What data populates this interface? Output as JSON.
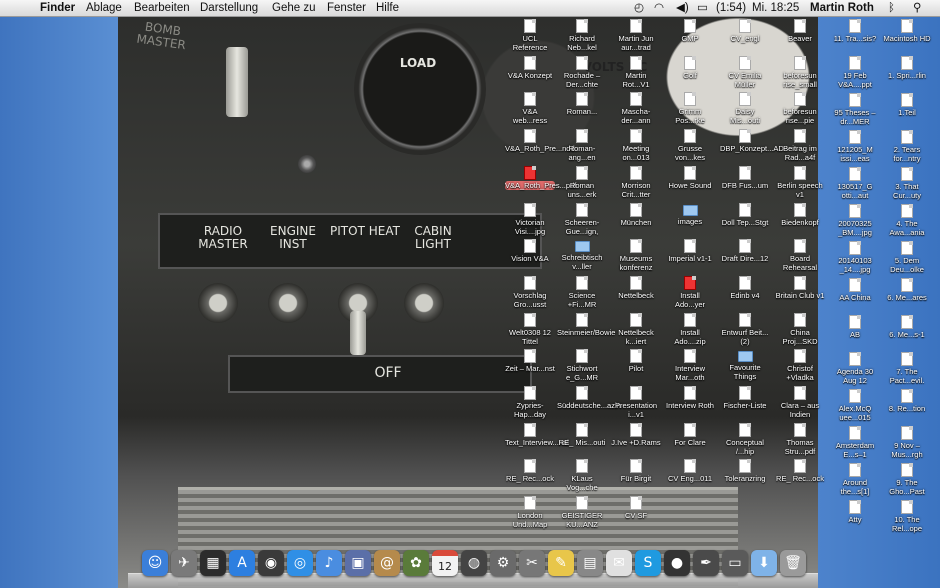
{
  "menubar": {
    "apple_icon": "apple-icon",
    "app_name": "Finder",
    "menus": [
      "Ablage",
      "Bearbeiten",
      "Darstellung",
      "Gehe zu",
      "Fenster",
      "Hilfe"
    ],
    "battery_text": "(1:54)",
    "clock": "Mi. 18:25",
    "user": "Martin Roth"
  },
  "wallpaper": {
    "gauge_top_label": "LOAD",
    "gauge_right_label": "VOLTS DC",
    "switch_labels": [
      "RADIO MASTER",
      "ENGINE INST",
      "PITOT HEAT",
      "CABIN LIGHT"
    ],
    "off_label": "OFF",
    "corner_label": "BOMB MASTER"
  },
  "desktop_icons": [
    {
      "label": "UCL Reference",
      "kind": "doc"
    },
    {
      "label": "Richard Neb...kel",
      "kind": "doc"
    },
    {
      "label": "Martin Jun aur...trad",
      "kind": "doc"
    },
    {
      "label": "GMP",
      "kind": "doc"
    },
    {
      "label": "CV_engl",
      "kind": "doc"
    },
    {
      "label": "Beaver",
      "kind": "doc"
    },
    {
      "label": "V&A Konzept",
      "kind": "doc"
    },
    {
      "label": "Rochade – Der...chte",
      "kind": "doc"
    },
    {
      "label": "Martin Rot...V1",
      "kind": "doc"
    },
    {
      "label": "Golf",
      "kind": "doc"
    },
    {
      "label": "CV Emilia Müller",
      "kind": "doc"
    },
    {
      "label": "beforesun rise_small",
      "kind": "doc"
    },
    {
      "label": "V&A web...ress",
      "kind": "doc"
    },
    {
      "label": "Roman...",
      "kind": "doc"
    },
    {
      "label": "Mascha-der...ann",
      "kind": "doc"
    },
    {
      "label": "Grimm Pos...rke",
      "kind": "doc"
    },
    {
      "label": "Daisy Mis...outi",
      "kind": "doc"
    },
    {
      "label": "beforesun rise...pie",
      "kind": "doc"
    },
    {
      "label": "V&A_Roth_Pre...ndd",
      "kind": "doc"
    },
    {
      "label": "Roman-ang...en",
      "kind": "doc"
    },
    {
      "label": "Meeting on...013",
      "kind": "doc"
    },
    {
      "label": "Grusse von...kes",
      "kind": "doc"
    },
    {
      "label": "DBP_Konzept...AD",
      "kind": "doc"
    },
    {
      "label": "Beitrag im Rad...a4f",
      "kind": "doc"
    },
    {
      "label": "V&A_Roth_Pres...pdf",
      "kind": "pdf",
      "selected": true
    },
    {
      "label": "Roman uns...erk",
      "kind": "doc"
    },
    {
      "label": "Morrison Crit...tter",
      "kind": "doc"
    },
    {
      "label": "Howe Sound",
      "kind": "doc"
    },
    {
      "label": "DFB Fus...um",
      "kind": "doc"
    },
    {
      "label": "Berlin speech v1",
      "kind": "doc"
    },
    {
      "label": "Victorian Visi....jpg",
      "kind": "doc"
    },
    {
      "label": "Scheeren-Gue...ign,",
      "kind": "doc"
    },
    {
      "label": "München",
      "kind": "doc"
    },
    {
      "label": "images",
      "kind": "folder"
    },
    {
      "label": "Doll Tep...Stgt",
      "kind": "doc"
    },
    {
      "label": "Biedenkopf",
      "kind": "doc"
    },
    {
      "label": "Vision V&A",
      "kind": "doc"
    },
    {
      "label": "Schreibtisch v...ller",
      "kind": "folder"
    },
    {
      "label": "Museums konferenz",
      "kind": "doc"
    },
    {
      "label": "Imperial v1-1",
      "kind": "doc"
    },
    {
      "label": "Draft Dire...12",
      "kind": "doc"
    },
    {
      "label": "Board Rehearsal",
      "kind": "doc"
    },
    {
      "label": "Vorschlag Gro...usst",
      "kind": "doc"
    },
    {
      "label": "Science +Fi...MR",
      "kind": "doc"
    },
    {
      "label": "Nettelbeck",
      "kind": "doc"
    },
    {
      "label": "Install Ado...yer",
      "kind": "pdf"
    },
    {
      "label": "Edinb v4",
      "kind": "doc"
    },
    {
      "label": "Britain Club v1",
      "kind": "doc"
    },
    {
      "label": "Welt0308 12 Tittel",
      "kind": "doc"
    },
    {
      "label": "Steinmeier/Bowie",
      "kind": "doc"
    },
    {
      "label": "Nettelbeck k...iert",
      "kind": "doc"
    },
    {
      "label": "Install Ado....zip",
      "kind": "doc"
    },
    {
      "label": "Entwurf Beit...(2)",
      "kind": "doc"
    },
    {
      "label": "China Proj...SKD",
      "kind": "doc"
    },
    {
      "label": "Zeit – Mar...nst",
      "kind": "doc"
    },
    {
      "label": "Stichwort e_G...MR",
      "kind": "doc"
    },
    {
      "label": "Pilot",
      "kind": "doc"
    },
    {
      "label": "Interview Mar...oth",
      "kind": "doc"
    },
    {
      "label": "Favourite Things",
      "kind": "folder"
    },
    {
      "label": "Christof +Vladka",
      "kind": "doc"
    },
    {
      "label": "Zypries-Hap...day",
      "kind": "doc"
    },
    {
      "label": "Süddeutsche...azin",
      "kind": "doc"
    },
    {
      "label": "Presentation i...v1",
      "kind": "doc"
    },
    {
      "label": "Interview Roth",
      "kind": "doc"
    },
    {
      "label": "Fischer-Liste",
      "kind": "doc"
    },
    {
      "label": "Clara – aus Indien",
      "kind": "doc"
    },
    {
      "label": "Text_Interview...nal",
      "kind": "doc"
    },
    {
      "label": "RE_ Mis...outi",
      "kind": "doc"
    },
    {
      "label": "J.Ive +D.Rams",
      "kind": "doc"
    },
    {
      "label": "For Clare",
      "kind": "doc"
    },
    {
      "label": "Conceptual /...hip",
      "kind": "doc"
    },
    {
      "label": "Thomas Stru...pdf",
      "kind": "doc"
    },
    {
      "label": "RE_ Rec...ock",
      "kind": "doc"
    },
    {
      "label": "KLaus Vog...che",
      "kind": "doc"
    },
    {
      "label": "Für Birgit",
      "kind": "doc"
    },
    {
      "label": "CV Eng...011",
      "kind": "doc"
    },
    {
      "label": "Toleranzring",
      "kind": "doc"
    },
    {
      "label": "RE_ Rec...ock",
      "kind": "doc"
    },
    {
      "label": "London Und...Map",
      "kind": "doc"
    },
    {
      "label": "GEISTIGER KU...ANZ",
      "kind": "doc"
    },
    {
      "label": "CV SF",
      "kind": "doc"
    },
    {
      "label": "11. Tra...sis?",
      "kind": "doc"
    },
    {
      "label": "Macintosh HD",
      "kind": "doc"
    },
    {
      "label": "19 Feb V&A....ppt",
      "kind": "doc"
    },
    {
      "label": "1. Spri...rlin",
      "kind": "doc"
    },
    {
      "label": "95 Theses – dr...MER",
      "kind": "doc"
    },
    {
      "label": "1.Teil",
      "kind": "doc"
    },
    {
      "label": "121205_M issi...eas",
      "kind": "doc"
    },
    {
      "label": "2. Tears for...ntry",
      "kind": "doc"
    },
    {
      "label": "130517_G otti...aut",
      "kind": "doc"
    },
    {
      "label": "3. That Cur...uty",
      "kind": "doc"
    },
    {
      "label": "20070325 _BM....jpg",
      "kind": "doc"
    },
    {
      "label": "4. The Awa...ania",
      "kind": "doc"
    },
    {
      "label": "20140103 _14....jpg",
      "kind": "doc"
    },
    {
      "label": "5. Dem Deu...olke",
      "kind": "doc"
    },
    {
      "label": "AA China",
      "kind": "doc"
    },
    {
      "label": "6. Me...ares",
      "kind": "doc"
    },
    {
      "label": "AB",
      "kind": "doc"
    },
    {
      "label": "6. Me...s-1",
      "kind": "doc"
    },
    {
      "label": "Agenda 30 Aug 12",
      "kind": "doc"
    },
    {
      "label": "7. The Pact...evil.",
      "kind": "doc"
    },
    {
      "label": "Alex.McQ uee...015",
      "kind": "doc"
    },
    {
      "label": "8. Re...tion",
      "kind": "doc"
    },
    {
      "label": "Amsterdam E...s–1",
      "kind": "doc"
    },
    {
      "label": "9 Nov – Mus...rgh",
      "kind": "doc"
    },
    {
      "label": "Around the...s[1]",
      "kind": "doc"
    },
    {
      "label": "9. The Gho...Past",
      "kind": "doc"
    },
    {
      "label": "Atty",
      "kind": "doc"
    },
    {
      "label": "10. The Rel...ope",
      "kind": "doc"
    }
  ],
  "dock": {
    "apps": [
      {
        "name": "finder-icon",
        "color": "#3b7fd9",
        "glyph": "☺"
      },
      {
        "name": "launchpad-icon",
        "color": "#7a7a7a",
        "glyph": "✈"
      },
      {
        "name": "mission-control-icon",
        "color": "#2c2c2c",
        "glyph": "▦"
      },
      {
        "name": "app-store-icon",
        "color": "#2d7fe0",
        "glyph": "A"
      },
      {
        "name": "dashboard-icon",
        "color": "#3a3a3a",
        "glyph": "◉"
      },
      {
        "name": "safari-icon",
        "color": "#2f8fe6",
        "glyph": "◎"
      },
      {
        "name": "itunes-icon",
        "color": "#4a8de0",
        "glyph": "♪"
      },
      {
        "name": "preview-icon",
        "color": "#5b6fa8",
        "glyph": "▣"
      },
      {
        "name": "contacts-icon",
        "color": "#b58a4c",
        "glyph": "@"
      },
      {
        "name": "iphoto-icon",
        "color": "#5a7b3a",
        "glyph": "✿"
      },
      {
        "name": "calendar-icon",
        "color": "#d94a3a",
        "glyph": "12"
      },
      {
        "name": "photo-booth-icon",
        "color": "#444444",
        "glyph": "◍"
      },
      {
        "name": "system-preferences-icon",
        "color": "#6a6a6a",
        "glyph": "⚙"
      },
      {
        "name": "grab-icon",
        "color": "#777777",
        "glyph": "✂"
      },
      {
        "name": "stickies-icon",
        "color": "#e8c64a",
        "glyph": "✎"
      },
      {
        "name": "image-capture-icon",
        "color": "#888888",
        "glyph": "▤"
      },
      {
        "name": "microsoft-office-icon",
        "color": "#e0e0e0",
        "glyph": "✉"
      },
      {
        "name": "skype-icon",
        "color": "#1f9ae0",
        "glyph": "S"
      },
      {
        "name": "camera-icon",
        "color": "#333333",
        "glyph": "●"
      },
      {
        "name": "script-editor-icon",
        "color": "#4a4a4a",
        "glyph": "✒"
      },
      {
        "name": "printer-icon",
        "color": "#5a5a5a",
        "glyph": "▭"
      },
      {
        "name": "downloads-folder-icon",
        "color": "#7fb3e8",
        "glyph": "⬇"
      },
      {
        "name": "trash-icon",
        "color": "#9a9a9a",
        "glyph": "🗑"
      }
    ]
  }
}
